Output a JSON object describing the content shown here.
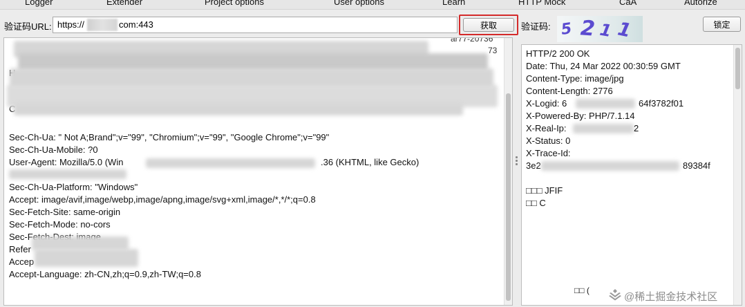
{
  "menu": {
    "tabs": [
      "Logger",
      "Extender",
      "Project options",
      "User options",
      "Learn",
      "HTTP Mock",
      "CaA",
      "Autorize"
    ]
  },
  "url_row": {
    "label": "验证码URL:",
    "value_start": "https://",
    "value_end": "com:443",
    "fetch_label": "获取"
  },
  "captcha": {
    "label": "验证码:",
    "chars": [
      "5",
      "2",
      "1",
      "1"
    ],
    "char_color": "#5b4bd0",
    "lock_label": "锁定"
  },
  "request": {
    "partial_top_right": [
      "ar77-20736",
      "73"
    ],
    "stray_chars": [
      "H",
      "C"
    ],
    "lines": [
      "Sec-Ch-Ua: \" Not A;Brand\";v=\"99\", \"Chromium\";v=\"99\", \"Google Chrome\";v=\"99\"",
      "Sec-Ch-Ua-Mobile: ?0",
      "User-Agent: Mozilla/5.0 (Win",
      "Sec-Ch-Ua-Platform: \"Windows\"",
      "Accept: image/avif,image/webp,image/apng,image/svg+xml,image/*,*/*;q=0.8",
      "Sec-Fetch-Site: same-origin",
      "Sec-Fetch-Mode: no-cors",
      "Sec-Fetch-Dest: image",
      "Refer",
      "Accep",
      "Accept-Language: zh-CN,zh;q=0.9,zh-TW;q=0.8"
    ],
    "ua_tail": ".36 (KHTML, like Gecko)"
  },
  "response": {
    "lines": [
      "HTTP/2 200 OK",
      "Date: Thu, 24 Mar 2022 00:30:59 GMT",
      "Content-Type: image/jpg",
      "Content-Length: 2776",
      "X-Logid: 6",
      "X-Powered-By: PHP/7.1.14",
      "X-Real-Ip:",
      "X-Status: 0",
      "X-Trace-Id:",
      "3e2",
      "",
      "□□□   JFIF",
      "□□  C"
    ],
    "logid_tail": "64f3782f01",
    "realip_tail": "2",
    "trace_tail": "89384f",
    "bottom_glyph": "□□  ("
  },
  "watermark": "@稀土掘金技术社区"
}
